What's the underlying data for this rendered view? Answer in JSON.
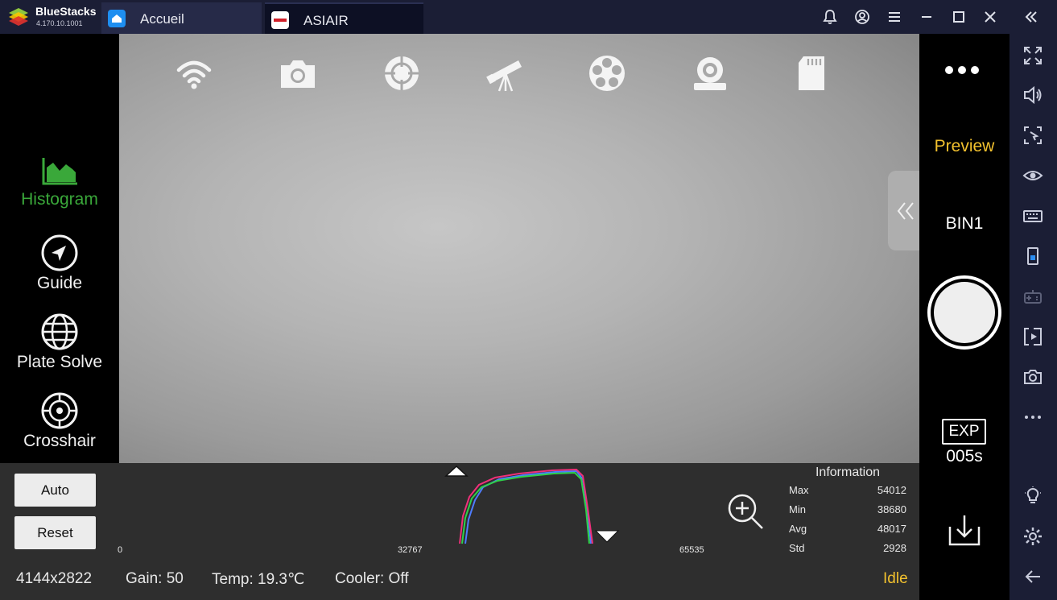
{
  "bluestacks": {
    "name": "BlueStacks",
    "version": "4.170.10.1001",
    "tabs": [
      {
        "label": "Accueil",
        "icon": "home-icon"
      },
      {
        "label": "ASIAIR",
        "icon": "asiair-app-icon"
      }
    ],
    "title_buttons": [
      "bell-icon",
      "account-icon",
      "menu-icon",
      "minimize-icon",
      "maximize-icon",
      "close-icon",
      "collapse-sidebar-icon"
    ],
    "sidebar_icons": [
      "fullscreen-icon",
      "volume-icon",
      "pointer-icon",
      "eye-icon",
      "keyboard-icon",
      "apk-icon",
      "gamepad-icon",
      "media-icon",
      "camera-icon",
      "more-icon",
      "light-icon",
      "settings-icon",
      "back-icon"
    ]
  },
  "left_nav": {
    "items": [
      {
        "label": "Histogram",
        "icon": "histogram-icon",
        "active": true
      },
      {
        "label": "Guide",
        "icon": "guide-icon"
      },
      {
        "label": "Plate Solve",
        "icon": "globe-icon"
      },
      {
        "label": "Crosshair",
        "icon": "crosshair-icon"
      }
    ]
  },
  "top_icons": [
    "wifi-icon",
    "camera-icon",
    "focus-target-icon",
    "telescope-icon",
    "filter-wheel-icon",
    "guide-camera-icon",
    "sd-card-icon"
  ],
  "right_panel": {
    "mode": "Preview",
    "bin": "BIN1",
    "exp_label": "EXP",
    "exp_value": "005s"
  },
  "histogram": {
    "auto_label": "Auto",
    "reset_label": "Reset",
    "axis": {
      "min": "0",
      "mid": "32767",
      "max": "65535"
    },
    "info_title": "Information",
    "info": [
      {
        "key": "Max",
        "value": "54012"
      },
      {
        "key": "Min",
        "value": "38680"
      },
      {
        "key": "Avg",
        "value": "48017"
      },
      {
        "key": "Std",
        "value": "2928"
      }
    ]
  },
  "status_bar": {
    "resolution": "4144x2822",
    "gain": "Gain: 50",
    "temp": "Temp: 19.3℃",
    "cooler": "Cooler: Off",
    "state": "Idle"
  },
  "colors": {
    "accent_yellow": "#f2c12e",
    "active_green": "#3aa83a",
    "chrome_navy": "#1b1e35"
  }
}
